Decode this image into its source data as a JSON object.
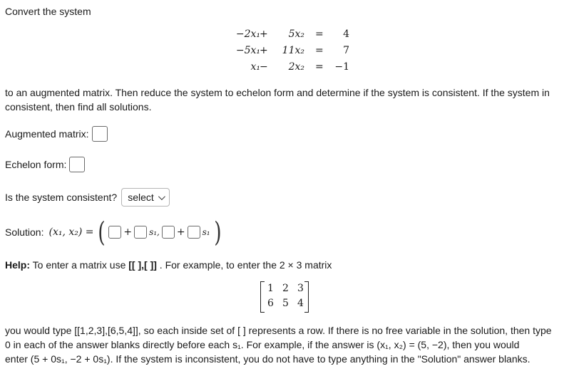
{
  "intro": "Convert the system",
  "system": {
    "rows": [
      {
        "t1": "−2x₁",
        "op": "+",
        "t2": "5x₂",
        "eq": "=",
        "rhs": "4"
      },
      {
        "t1": "−5x₁",
        "op": "+",
        "t2": "11x₂",
        "eq": "=",
        "rhs": "7"
      },
      {
        "t1": "x₁",
        "op": "−",
        "t2": "2x₂",
        "eq": "=",
        "rhs": "−1"
      }
    ]
  },
  "instructions": "to an augmented matrix. Then reduce the system to echelon form and determine if the system is consistent. If the system in consistent, then find all solutions.",
  "augmented_label": "Augmented matrix:",
  "echelon_label": "Echelon form:",
  "consistent_label": "Is the system consistent?",
  "consistent_select": "select",
  "solution": {
    "label": "Solution:",
    "lhs": "(x₁, x₂) =",
    "plus": "+",
    "s1": "s₁,",
    "s1_end": "s₁"
  },
  "help": {
    "bold": "Help:",
    "text1": " To enter a matrix use ",
    "code": "[[ ],[ ]]",
    "text2": " . For example, to enter the 2 × 3 matrix",
    "matrix": [
      [
        "1",
        "2",
        "3"
      ],
      [
        "6",
        "5",
        "4"
      ]
    ]
  },
  "footer": {
    "line1": "you would type [[1,2,3],[6,5,4]], so each inside set of [ ] represents a row. If there is no free variable in the solution, then type",
    "line2": "0 in each of the answer blanks directly before each s₁. For example, if the answer is (x₁, x₂) = (5, −2), then you would",
    "line3": "enter (5 + 0s₁, −2 + 0s₁). If the system is inconsistent, you do not have to type anything in the \"Solution\" answer blanks."
  }
}
